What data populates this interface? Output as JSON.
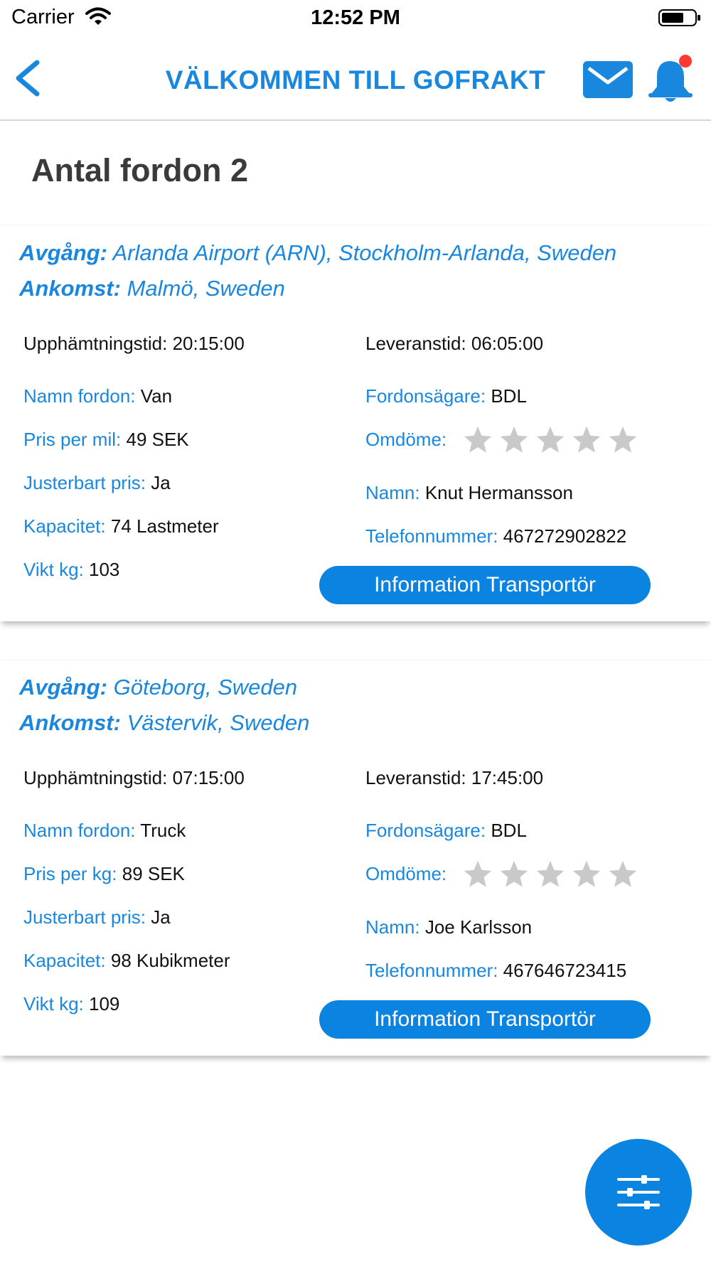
{
  "status_bar": {
    "carrier": "Carrier",
    "time": "12:52 PM"
  },
  "nav": {
    "title": "VÄLKOMMEN TILL GOFRAKT",
    "icons": [
      "back-chevron-icon",
      "mail-icon",
      "bell-icon"
    ],
    "accent_color": "#1a87de",
    "badge_color": "#ff3b30"
  },
  "page": {
    "title": "Antal fordon 2"
  },
  "cards": [
    {
      "departure_label": "Avgång:",
      "departure": "Arlanda Airport (ARN), Stockholm-Arlanda, Sweden",
      "arrival_label": "Ankomst:",
      "arrival": "Malmö, Sweden",
      "pickup_label": "Upphämtningstid:",
      "pickup": "20:15:00",
      "delivery_label": "Leveranstid:",
      "delivery": "06:05:00",
      "vehicle_label": "Namn fordon:",
      "vehicle": "Van",
      "owner_label": "Fordonsägare:",
      "owner": "BDL",
      "price_label": "Pris per mil:",
      "price": "49 SEK",
      "rating_label": "Omdöme:",
      "rating": 0,
      "rating_max": 5,
      "adjustable_label": "Justerbart pris:",
      "adjustable": "Ja",
      "name_label": "Namn:",
      "name": "Knut Hermansson",
      "capacity_label": "Kapacitet:",
      "capacity": "74 Lastmeter",
      "phone_label": "Telefonnummer:",
      "phone": "467272902822",
      "weight_label": "Vikt kg:",
      "weight": "103",
      "button": "Information Transportör"
    },
    {
      "departure_label": "Avgång:",
      "departure": "Göteborg, Sweden",
      "arrival_label": "Ankomst:",
      "arrival": "Västervik, Sweden",
      "pickup_label": "Upphämtningstid:",
      "pickup": "07:15:00",
      "delivery_label": "Leveranstid:",
      "delivery": "17:45:00",
      "vehicle_label": "Namn fordon:",
      "vehicle": "Truck",
      "owner_label": "Fordonsägare:",
      "owner": "BDL",
      "price_label": "Pris per kg:",
      "price": "89 SEK",
      "rating_label": "Omdöme:",
      "rating": 0,
      "rating_max": 5,
      "adjustable_label": "Justerbart pris:",
      "adjustable": "Ja",
      "name_label": "Namn:",
      "name": "Joe Karlsson",
      "capacity_label": "Kapacitet:",
      "capacity": "98 Kubikmeter",
      "phone_label": "Telefonnummer:",
      "phone": "467646723415",
      "weight_label": "Vikt kg:",
      "weight": "109",
      "button": "Information Transportör"
    }
  ],
  "fab": {
    "icon": "filter-sliders-icon"
  }
}
